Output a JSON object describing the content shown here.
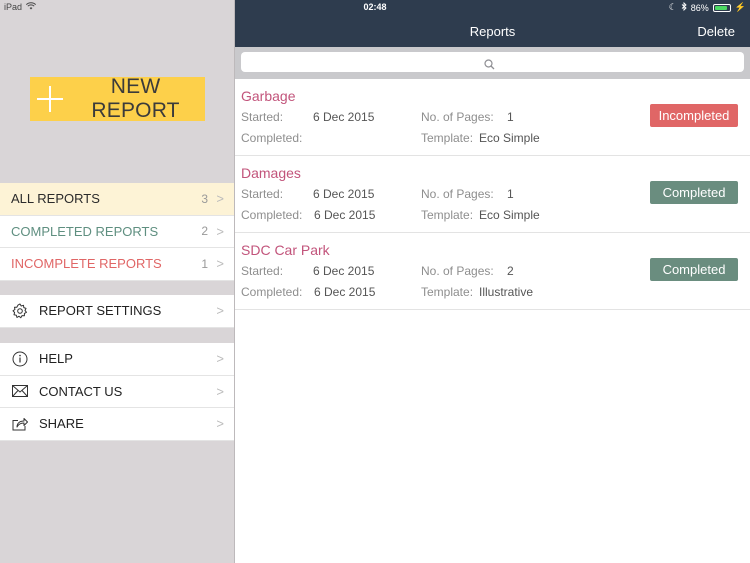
{
  "status_bar": {
    "device": "iPad",
    "time": "02:48",
    "battery": "86%",
    "battery_level": 0.86
  },
  "colors": {
    "new_report_bg": "#fdd04a",
    "navbar_bg": "#2e3c4e",
    "report_name": "#c2547b",
    "incompleted": "#e06666",
    "completed": "#6a8d7f",
    "completed_menu": "#5f8f80",
    "incomplete_menu": "#e06666"
  },
  "sidebar": {
    "new_report_label": "NEW REPORT",
    "reports_menu": [
      {
        "label": "ALL REPORTS",
        "count": "3",
        "color": "#2b2b2b"
      },
      {
        "label": "COMPLETED REPORTS",
        "count": "2",
        "color": "#5f8f80"
      },
      {
        "label": "INCOMPLETE REPORTS",
        "count": "1",
        "color": "#e06666"
      }
    ],
    "settings_label": "REPORT SETTINGS",
    "help_label": "HELP",
    "contact_label": "CONTACT US",
    "share_label": "SHARE",
    "icons": {
      "settings": "gear-icon",
      "help": "info-icon",
      "contact": "envelope-icon",
      "share": "share-icon"
    }
  },
  "header": {
    "title": "Reports",
    "delete_label": "Delete"
  },
  "search": {
    "placeholder": ""
  },
  "field_labels": {
    "started": "Started:",
    "completed": "Completed:",
    "pages": "No. of Pages:",
    "template": "Template:"
  },
  "reports": [
    {
      "name": "Garbage",
      "started": "6 Dec 2015",
      "completed": "",
      "pages": "1",
      "template": "Eco Simple",
      "status": "Incompleted",
      "status_color": "#e06666"
    },
    {
      "name": "Damages",
      "started": "6 Dec 2015",
      "completed": "6 Dec 2015",
      "pages": "1",
      "template": "Eco Simple",
      "status": "Completed",
      "status_color": "#6a8d7f"
    },
    {
      "name": "SDC Car Park",
      "started": "6 Dec 2015",
      "completed": "6 Dec 2015",
      "pages": "2",
      "template": "Illustrative",
      "status": "Completed",
      "status_color": "#6a8d7f"
    }
  ]
}
